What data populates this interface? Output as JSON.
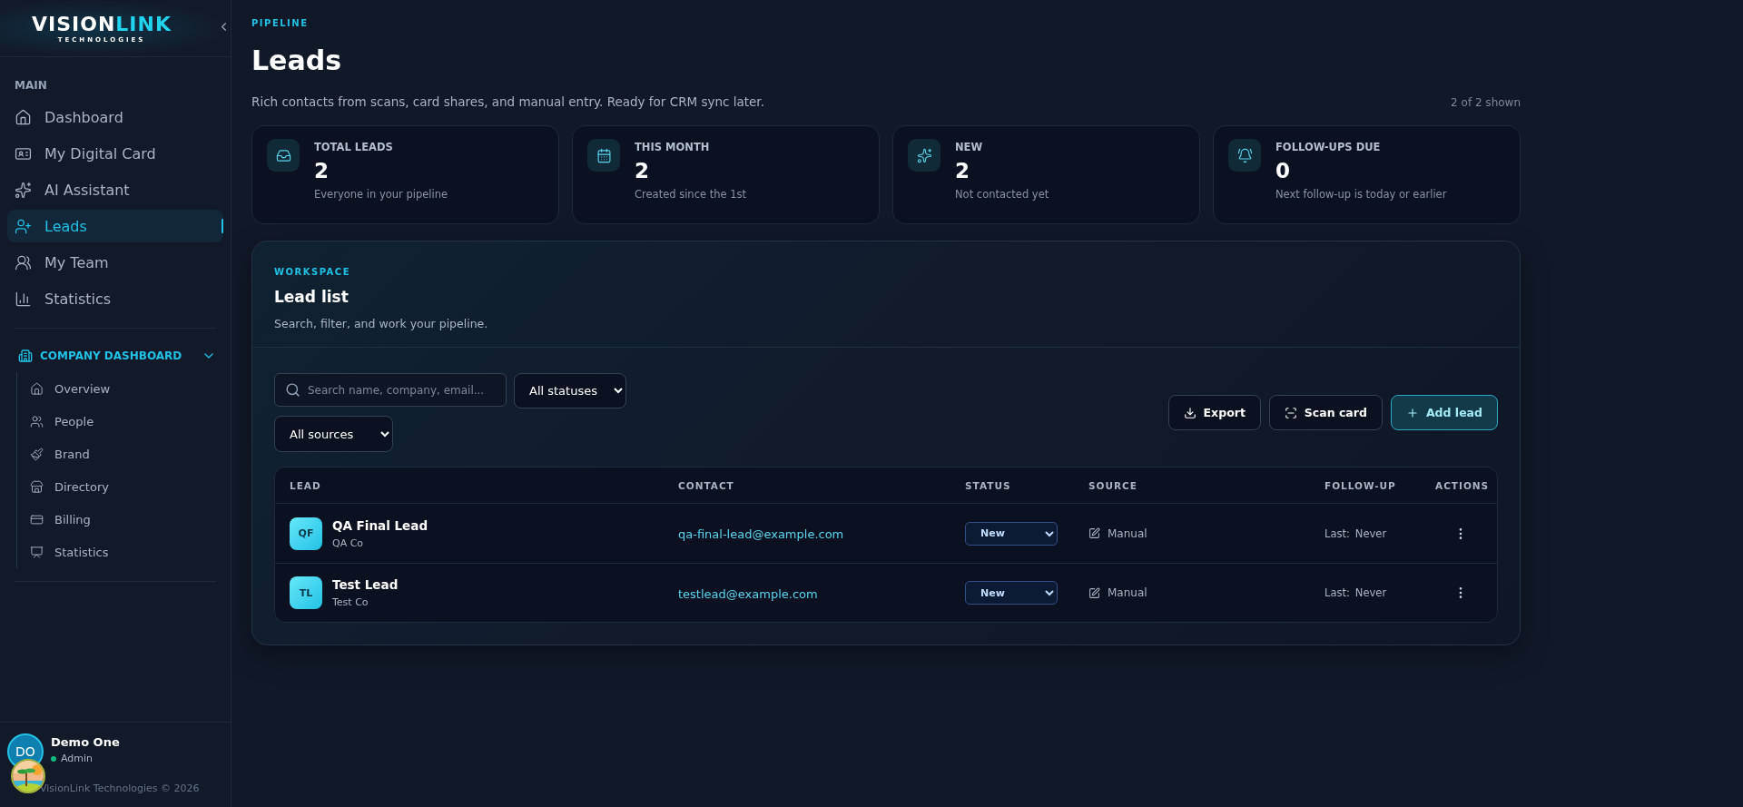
{
  "sidebar": {
    "logo": {
      "primary": "VISION",
      "accent": "LINK",
      "sub": "TECHNOLOGIES"
    },
    "main_section": {
      "label": "MAIN",
      "items": [
        {
          "label": "Dashboard",
          "selected": false
        },
        {
          "label": "My Digital Card",
          "selected": false
        },
        {
          "label": "AI Assistant",
          "selected": false
        },
        {
          "label": "Leads",
          "selected": true
        },
        {
          "label": "My Team",
          "selected": false
        },
        {
          "label": "Statistics",
          "selected": false
        }
      ]
    },
    "company_section": {
      "label": "COMPANY DASHBOARD",
      "expanded": true,
      "items": [
        {
          "label": "Overview",
          "selected": false
        },
        {
          "label": "People",
          "selected": false
        },
        {
          "label": "Brand",
          "selected": false
        },
        {
          "label": "Directory",
          "selected": false
        },
        {
          "label": "Billing",
          "selected": false
        },
        {
          "label": "Statistics",
          "selected": false
        }
      ]
    },
    "user": {
      "initials": "DO",
      "name": "Demo One",
      "role": "Admin",
      "online": true
    },
    "copyright": "VisionLink Technologies © 2026"
  },
  "header": {
    "eyebrow": "PIPELINE",
    "title": "Leads",
    "subtitle": "Rich contacts from scans, card shares, and manual entry. Ready for CRM sync later.",
    "count": "2 of 2 shown"
  },
  "stats": [
    {
      "label": "TOTAL LEADS",
      "value": "2",
      "note": "Everyone in your pipeline"
    },
    {
      "label": "THIS MONTH",
      "value": "2",
      "note": "Created since the 1st"
    },
    {
      "label": "NEW",
      "value": "2",
      "note": "Not contacted yet"
    },
    {
      "label": "FOLLOW-UPS DUE",
      "value": "0",
      "note": "Next follow-up is today or earlier"
    }
  ],
  "workspace": {
    "eyebrow": "WORKSPACE",
    "title": "Lead list",
    "subtitle": "Search, filter, and work your pipeline.",
    "search": {
      "placeholder": "Search name, company, email..."
    },
    "filters": [
      {
        "value": "All statuses"
      },
      {
        "value": "All sources"
      }
    ],
    "buttons": [
      {
        "label": "Export",
        "kind": "plain"
      },
      {
        "label": "Scan card",
        "kind": "plain"
      },
      {
        "label": "Add lead",
        "kind": "primary"
      }
    ],
    "table": {
      "columns": [
        "LEAD",
        "CONTACT",
        "STATUS",
        "SOURCE",
        "FOLLOW-UP",
        "ACTIONS"
      ],
      "rows": [
        {
          "initials": "QF",
          "name": "QA Final Lead",
          "company": "QA Co",
          "email": "qa-final-lead@example.com",
          "status": "New",
          "source": "Manual",
          "followup_label": "Last:",
          "followup": "Never"
        },
        {
          "initials": "TL",
          "name": "Test Lead",
          "company": "Test Co",
          "email": "testlead@example.com",
          "status": "New",
          "source": "Manual",
          "followup_label": "Last:",
          "followup": "Never"
        }
      ]
    }
  }
}
